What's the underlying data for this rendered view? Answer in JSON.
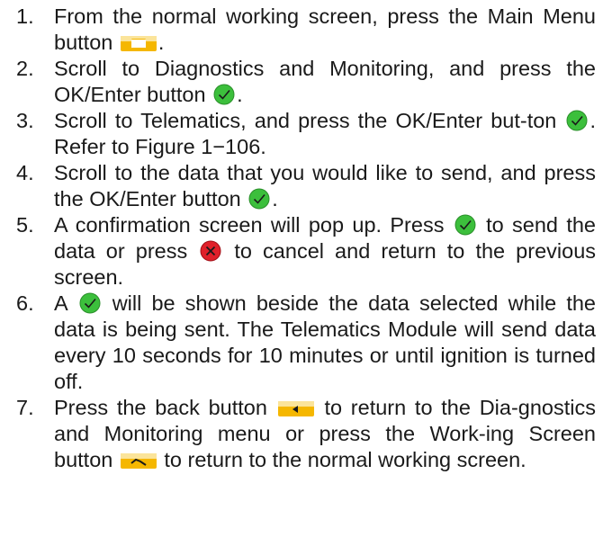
{
  "steps": [
    {
      "num": "1.",
      "a": "From the normal working screen, press the Main Menu button",
      "icon1": "main-menu-button-icon",
      "b": "."
    },
    {
      "num": "2.",
      "a": "Scroll to Diagnostics and Monitoring, and press the OK/Enter button",
      "icon1": "ok-enter-check-icon",
      "b": "."
    },
    {
      "num": "3.",
      "a": "Scroll to Telematics, and press the OK/Enter but-ton",
      "icon1": "ok-enter-check-icon",
      "b": ".  Refer to Figure 1−106."
    },
    {
      "num": "4.",
      "a": "Scroll to the data that you would like to send, and press the OK/Enter button",
      "icon1": "ok-enter-check-icon",
      "b": "."
    },
    {
      "num": "5.",
      "a": "A confirmation screen will pop up.  Press",
      "icon1": "ok-enter-check-icon",
      "b": "to send the data or press",
      "icon2": "cancel-x-icon",
      "c": "to cancel and return to the previous screen."
    },
    {
      "num": "6.",
      "a": "A",
      "icon1": "ok-enter-check-icon",
      "b": "will be shown beside the data selected while the data is being sent.  The Telematics Module will send data every 10 seconds for 10 minutes or until ignition is turned off."
    },
    {
      "num": "7.",
      "a": "Press the back button",
      "icon1": "back-button-icon",
      "b": "to return to the Dia-gnostics and Monitoring menu or press the Work-ing Screen button",
      "icon2": "working-screen-button-icon",
      "c": "to return to the normal working screen."
    }
  ],
  "colors": {
    "ok": "#3cbf3c",
    "cancel": "#e0202a",
    "button": "#f5b700"
  }
}
